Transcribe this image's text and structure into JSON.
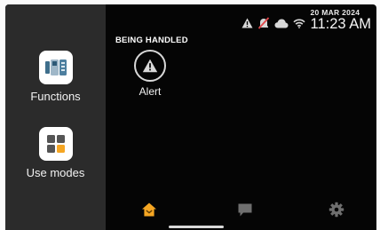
{
  "sidebar": {
    "items": [
      {
        "label": "Functions",
        "icon": "intercom-icon"
      },
      {
        "label": "Use modes",
        "icon": "grid-icon"
      }
    ]
  },
  "status": {
    "date": "20 MAR 2024",
    "time": "11:23 AM",
    "icons": [
      "warning-icon",
      "notifications-muted-icon",
      "cloud-icon",
      "wifi-icon"
    ]
  },
  "main": {
    "section_title": "BEING HANDLED",
    "alert_label": "Alert"
  },
  "tabs": [
    {
      "name": "home",
      "icon": "home-icon",
      "active": true
    },
    {
      "name": "messages",
      "icon": "chat-icon",
      "active": false
    },
    {
      "name": "settings",
      "icon": "gear-icon",
      "active": false
    }
  ],
  "colors": {
    "accent": "#f5a623",
    "muted_accent": "#e1474a",
    "background": "#050505",
    "sidebar": "#2b2b2b"
  }
}
